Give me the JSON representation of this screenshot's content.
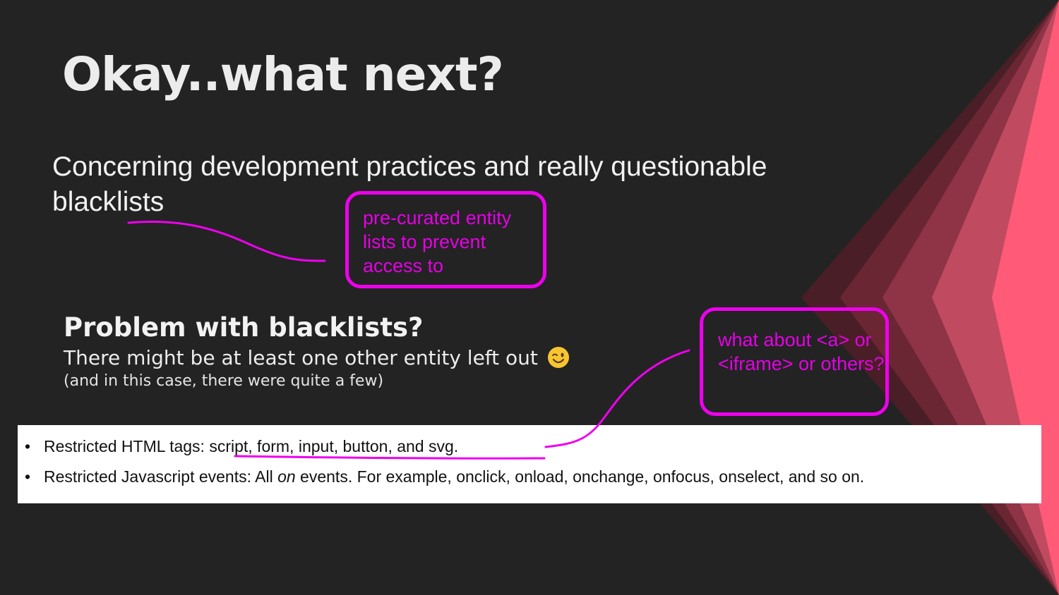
{
  "slide": {
    "title": "Okay..what next?",
    "subtitle": "Concerning development practices and really questionable blacklists",
    "callout_1": "pre-curated entity lists to prevent access to",
    "problem_heading": "Problem with blacklists?",
    "problem_line": "There might be at least one other entity left out",
    "problem_emoji": "winking-face",
    "problem_note": "(and in this case, there were quite a few)",
    "callout_2": "what about <a> or <iframe> or others?",
    "restrictions": {
      "html_tags_prefix": "Restricted HTML tags: ",
      "html_tags_list": "script, form, input, button, and svg.",
      "js_events_prefix": "Restricted Javascript events: All ",
      "js_events_italic": "on",
      "js_events_suffix": " events. For example, onclick, onload, onchange, onfocus, onselect, and so on."
    }
  },
  "colors": {
    "background": "#232323",
    "annotation": "#ee00ee",
    "accent": "#ff5a78"
  }
}
